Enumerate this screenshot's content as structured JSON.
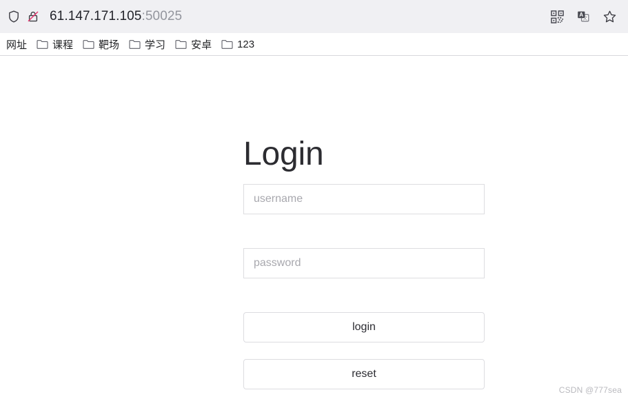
{
  "browser": {
    "address_bar": {
      "shield_icon": "shield-icon",
      "security_icon": "insecure-lock-icon",
      "url_host": "61.147.171.105",
      "url_port": ":50025",
      "url_full": "61.147.171.105:50025",
      "actions": [
        {
          "name": "qr-code-icon",
          "label": "QR code"
        },
        {
          "name": "translate-icon",
          "label": "Translate"
        },
        {
          "name": "bookmark-star-icon",
          "label": "Bookmark"
        }
      ]
    },
    "bookmarks": [
      {
        "label": "网址",
        "has_folder_icon": false
      },
      {
        "label": "课程",
        "has_folder_icon": true
      },
      {
        "label": "靶场",
        "has_folder_icon": true
      },
      {
        "label": "学习",
        "has_folder_icon": true
      },
      {
        "label": "安卓",
        "has_folder_icon": true
      },
      {
        "label": "123",
        "has_folder_icon": true
      }
    ]
  },
  "page": {
    "title": "Login",
    "username": {
      "placeholder": "username",
      "value": ""
    },
    "password": {
      "placeholder": "password",
      "value": ""
    },
    "login_button": "login",
    "reset_button": "reset",
    "watermark": "CSDN @777sea"
  },
  "colors": {
    "chrome_background": "#f0f0f3",
    "page_background": "#ffffff",
    "input_border": "#dddde0",
    "button_border": "#dcdce0",
    "placeholder": "#a8a8ae",
    "title": "#2c2c31",
    "insecure_strike": "#e8336d",
    "watermark": "#b9b9be"
  }
}
